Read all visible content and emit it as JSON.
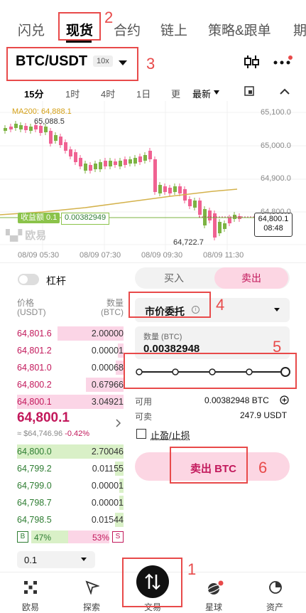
{
  "top_nav": {
    "tabs": [
      "闪兑",
      "现货",
      "合约",
      "链上",
      "策略&跟单",
      "期"
    ]
  },
  "pair": {
    "symbol": "BTC/USDT",
    "leverage": "10x"
  },
  "timeframes": [
    "15分",
    "1时",
    "4时",
    "1日",
    "更",
    "最新"
  ],
  "chart": {
    "ma_label": "MA200: 64,888.1",
    "high_label": "65,088.5",
    "low_label": "64,722.7",
    "pnl_label": "收益额 0.1",
    "pnl_value": "0.00382949",
    "price_tag": "64,800.1",
    "countdown": "08:48",
    "watermark": "欧易",
    "y_labels": [
      "65,100.0",
      "65,000.0",
      "64,900.0",
      "64,800.0"
    ],
    "x_labels": [
      "08/09 05:30",
      "08/09 07:30",
      "08/09 09:30",
      "08/09 11:30"
    ]
  },
  "leverage_toggle": {
    "label": "杠杆"
  },
  "orderbook": {
    "price_header": "价格",
    "price_unit": "(USDT)",
    "qty_header": "数量",
    "qty_unit": "(BTC)",
    "asks": [
      {
        "price": "64,801.6",
        "qty": "2.00000",
        "fill": 0.62
      },
      {
        "price": "64,801.2",
        "qty": "0.00001",
        "fill": 0.05
      },
      {
        "price": "64,801.0",
        "qty": "0.00068",
        "fill": 0.07
      },
      {
        "price": "64,800.2",
        "qty": "0.67966",
        "fill": 0.35
      },
      {
        "price": "64,800.1",
        "qty": "3.04921",
        "fill": 1.0
      }
    ],
    "mid_price": "64,800.1",
    "mid_usd": "≈ $64,746.96",
    "mid_change": "-0.42%",
    "bids": [
      {
        "price": "64,800.0",
        "qty": "2.70046",
        "fill": 1.0
      },
      {
        "price": "64,799.2",
        "qty": "0.01155",
        "fill": 0.08
      },
      {
        "price": "64,799.0",
        "qty": "0.00001",
        "fill": 0.04
      },
      {
        "price": "64,798.7",
        "qty": "0.00001",
        "fill": 0.04
      },
      {
        "price": "64,798.5",
        "qty": "0.01544",
        "fill": 0.08
      }
    ],
    "buy_ratio_badge": "B",
    "buy_ratio": "47%",
    "sell_ratio": "53%",
    "sell_ratio_badge": "S",
    "depth_select": "0.1"
  },
  "trade_panel": {
    "buy_tab": "买入",
    "sell_tab": "卖出",
    "order_type": "市价委托",
    "qty_label": "数量 (BTC)",
    "qty_value": "0.00382948",
    "slider_level": 1.0,
    "available_label": "可用",
    "available_value": "0.00382948 BTC",
    "sellable_label": "可卖",
    "sellable_value": "247.9 USDT",
    "tpsl_label": "止盈/止损",
    "sell_button": "卖出 BTC"
  },
  "bottom_nav": {
    "items": [
      "欧易",
      "探索",
      "交易",
      "星球",
      "资产"
    ]
  },
  "annotations": [
    "1",
    "2",
    "3",
    "4",
    "5",
    "6"
  ],
  "colors": {
    "up": "#7cb342",
    "down": "#f06292",
    "accent_pink": "#fcd6e3",
    "annotation_red": "#e84a4a"
  }
}
